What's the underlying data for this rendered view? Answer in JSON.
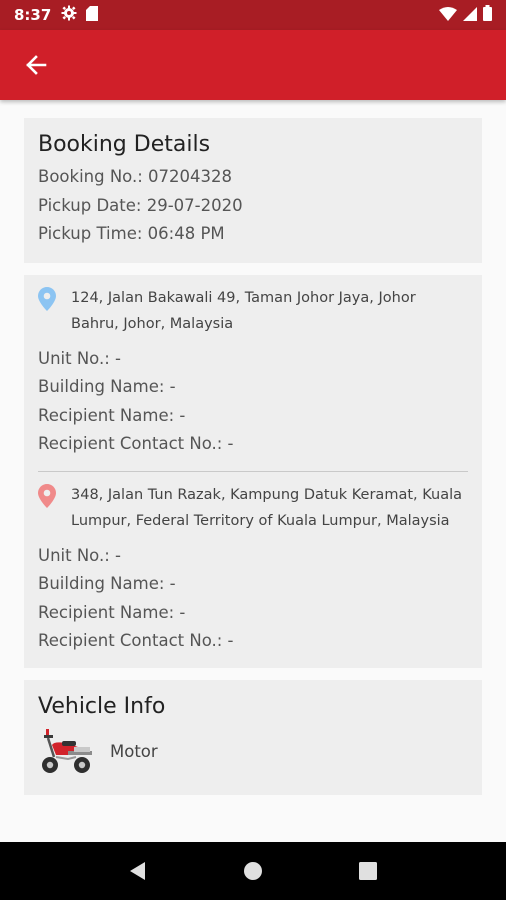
{
  "status_bar": {
    "time": "8:37",
    "icons": [
      "gear-icon",
      "sd-card-icon",
      "wifi-icon",
      "signal-icon",
      "battery-icon"
    ]
  },
  "app_bar": {
    "back_icon": "arrow-back-icon",
    "color": "#d01f29"
  },
  "booking": {
    "title": "Booking Details",
    "booking_no": "Booking No.: 07204328",
    "pickup_date": "Pickup Date: 29-07-2020",
    "pickup_time": "Pickup Time: 06:48 PM"
  },
  "pickup": {
    "pin_color": "#8cc4f2",
    "address": "124, Jalan Bakawali 49, Taman Johor Jaya, Johor Bahru, Johor, Malaysia",
    "unit_no": "Unit No.: -",
    "building_name": "Building Name: -",
    "recipient_name": "Recipient Name: -",
    "recipient_contact": "Recipient Contact No.: -"
  },
  "dropoff": {
    "pin_color": "#f08a8a",
    "address": "348, Jalan Tun Razak, Kampung Datuk Keramat, Kuala Lumpur, Federal Territory of Kuala Lumpur, Malaysia",
    "unit_no": "Unit No.: -",
    "building_name": "Building Name: -",
    "recipient_name": "Recipient Name: -",
    "recipient_contact": "Recipient Contact No.: -"
  },
  "vehicle": {
    "title": "Vehicle Info",
    "type": "Motor",
    "icon": "motorcycle-icon"
  },
  "nav": {
    "icons": [
      "back-triangle-icon",
      "home-circle-icon",
      "recents-square-icon"
    ]
  }
}
